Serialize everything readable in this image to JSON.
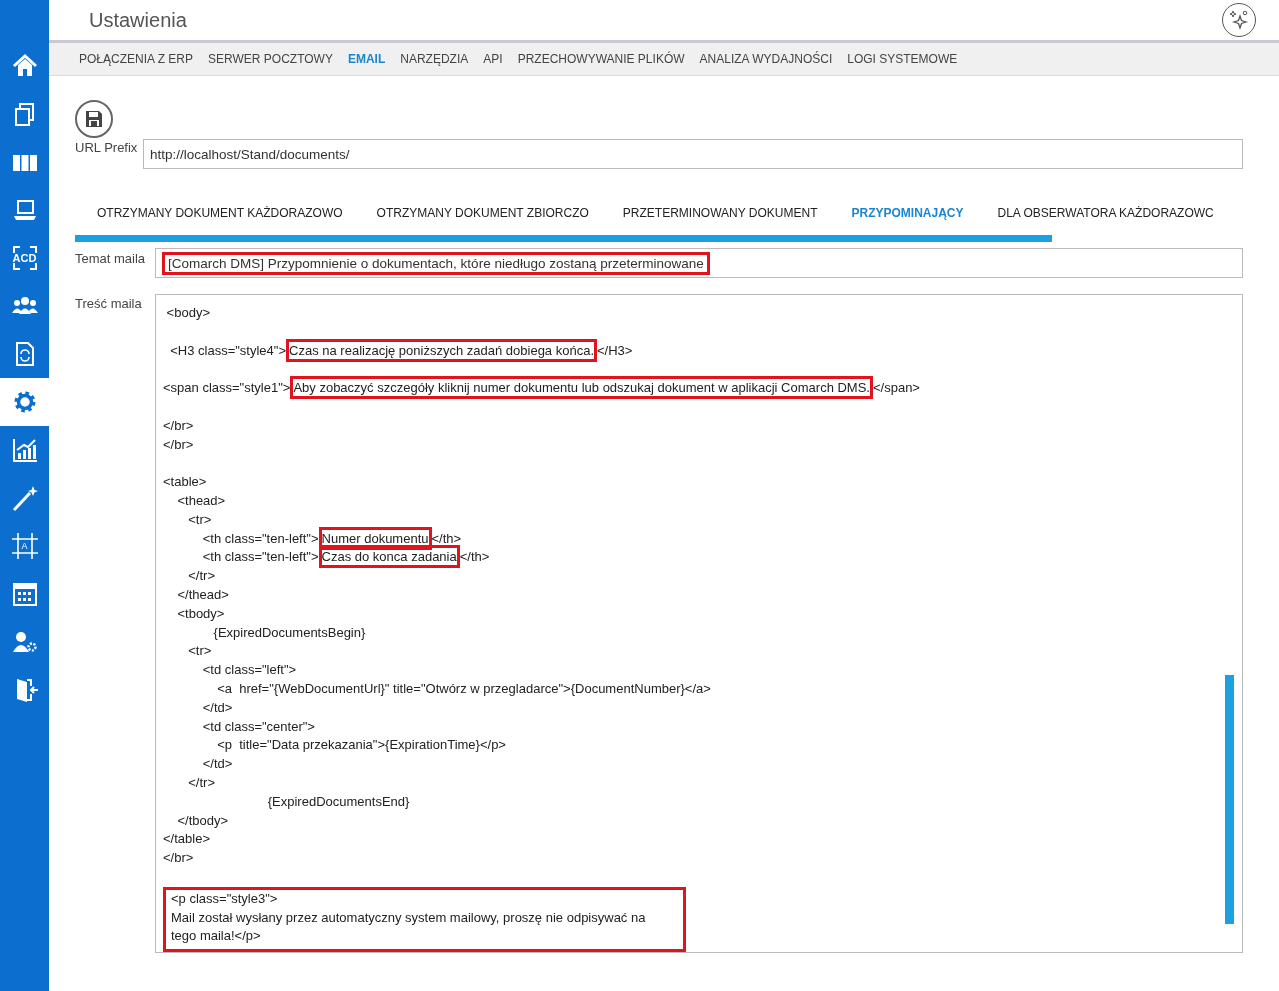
{
  "app": {
    "title": "Ustawienia"
  },
  "sidebar": {
    "items": [
      {
        "selected": false
      },
      {
        "selected": false
      },
      {
        "selected": false
      },
      {
        "selected": false
      },
      {
        "label": "ACD",
        "selected": false
      },
      {
        "selected": false
      },
      {
        "selected": false
      },
      {
        "selected": true
      },
      {
        "selected": false
      },
      {
        "selected": false
      },
      {
        "label": "A",
        "selected": false
      },
      {
        "selected": false
      },
      {
        "selected": false
      },
      {
        "selected": false
      }
    ]
  },
  "nav_tabs": [
    {
      "label": "POŁĄCZENIA Z ERP",
      "selected": false
    },
    {
      "label": "SERWER POCZTOWY",
      "selected": false
    },
    {
      "label": "EMAIL",
      "selected": true
    },
    {
      "label": "NARZĘDZIA",
      "selected": false
    },
    {
      "label": "API",
      "selected": false
    },
    {
      "label": "PRZECHOWYWANIE PLIKÓW",
      "selected": false
    },
    {
      "label": "ANALIZA WYDAJNOŚCI",
      "selected": false
    },
    {
      "label": "LOGI SYSTEMOWE",
      "selected": false
    }
  ],
  "url_prefix": {
    "label": "URL Prefix",
    "value": "http://localhost/Stand/documents/"
  },
  "email_tabs": [
    {
      "label": "OTRZYMANY DOKUMENT KAŻDORAZOWO",
      "selected": false
    },
    {
      "label": "OTRZYMANY DOKUMENT ZBIORCZO",
      "selected": false
    },
    {
      "label": "PRZETERMINOWANY DOKUMENT",
      "selected": false
    },
    {
      "label": "PRZYPOMINAJĄCY",
      "selected": true
    },
    {
      "label": "DLA OBSERWATORA KAŻDORAZOWC",
      "selected": false
    }
  ],
  "subject": {
    "label": "Temat maila",
    "value": "[Comarch DMS] Przypomnienie o dokumentach, które niedługo zostaną przeterminowane",
    "highlighted": true
  },
  "body": {
    "label": "Treść maila",
    "blocks": [
      {
        "highlighted": false,
        "lines": [
          [
            {
              "text": " <body>",
              "highlighted": false
            }
          ]
        ]
      },
      {
        "highlighted": false,
        "lines": [
          [
            {
              "text": "  <H3 class=\"style4\">",
              "highlighted": false
            },
            {
              "text": "Czas na realizację poniższych zadań dobiega końca.",
              "highlighted": true
            },
            {
              "text": "</H3>",
              "highlighted": false
            }
          ]
        ]
      },
      {
        "highlighted": false,
        "lines": [
          [
            {
              "text": "<span class=\"style1\">",
              "highlighted": false
            },
            {
              "text": "Aby zobaczyć szczegóły kliknij numer dokumentu lub odszukaj dokument w aplikacji Comarch DMS.",
              "highlighted": true
            },
            {
              "text": "</span>",
              "highlighted": false
            }
          ]
        ]
      },
      {
        "highlighted": false,
        "lines": [
          [
            {
              "text": "</br>",
              "highlighted": false
            }
          ],
          [
            {
              "text": "</br>",
              "highlighted": false
            }
          ]
        ]
      },
      {
        "highlighted": false,
        "lines": [
          [
            {
              "text": "<table>",
              "highlighted": false
            }
          ],
          [
            {
              "text": "    <thead>",
              "highlighted": false
            }
          ],
          [
            {
              "text": "       <tr>",
              "highlighted": false
            }
          ],
          [
            {
              "text": "           <th class=\"ten-left\">",
              "highlighted": false
            },
            {
              "text": "Numer dokumentu",
              "highlighted": true
            },
            {
              "text": "</th>",
              "highlighted": false
            }
          ],
          [
            {
              "text": "           <th class=\"ten-left\">",
              "highlighted": false
            },
            {
              "text": "Czas do konca zadania",
              "highlighted": true
            },
            {
              "text": "</th>",
              "highlighted": false
            }
          ],
          [
            {
              "text": "       </tr>",
              "highlighted": false
            }
          ],
          [
            {
              "text": "    </thead>",
              "highlighted": false
            }
          ],
          [
            {
              "text": "    <tbody>",
              "highlighted": false
            }
          ],
          [
            {
              "text": "              {ExpiredDocumentsBegin}",
              "highlighted": false
            }
          ],
          [
            {
              "text": "       <tr>",
              "highlighted": false
            }
          ],
          [
            {
              "text": "           <td class=\"left\">",
              "highlighted": false
            }
          ],
          [
            {
              "text": "               <a  href=\"{WebDocumentUrl}\" title=\"Otwórz w przegladarce\">{DocumentNumber}</a>",
              "highlighted": false
            }
          ],
          [
            {
              "text": "           </td>",
              "highlighted": false
            }
          ],
          [
            {
              "text": "           <td class=\"center\">",
              "highlighted": false
            }
          ],
          [
            {
              "text": "               <p  title=\"Data przekazania\">{ExpirationTime}</p>",
              "highlighted": false
            }
          ],
          [
            {
              "text": "           </td>",
              "highlighted": false
            }
          ],
          [
            {
              "text": "       </tr>",
              "highlighted": false
            }
          ],
          [
            {
              "text": "                             {ExpiredDocumentsEnd}",
              "highlighted": false
            }
          ],
          [
            {
              "text": "    </tbody>",
              "highlighted": false
            }
          ],
          [
            {
              "text": "</table>",
              "highlighted": false
            }
          ],
          [
            {
              "text": "</br>",
              "highlighted": false
            }
          ]
        ]
      },
      {
        "highlighted": true,
        "lines": [
          [
            {
              "text": "<p class=\"style3\">",
              "highlighted": false
            }
          ],
          [
            {
              "text": "Mail został wysłany przez automatyczny system mailowy, proszę nie odpisywać na",
              "highlighted": false
            }
          ],
          [
            {
              "text": "tego maila!</p>",
              "highlighted": false
            }
          ]
        ]
      }
    ]
  }
}
